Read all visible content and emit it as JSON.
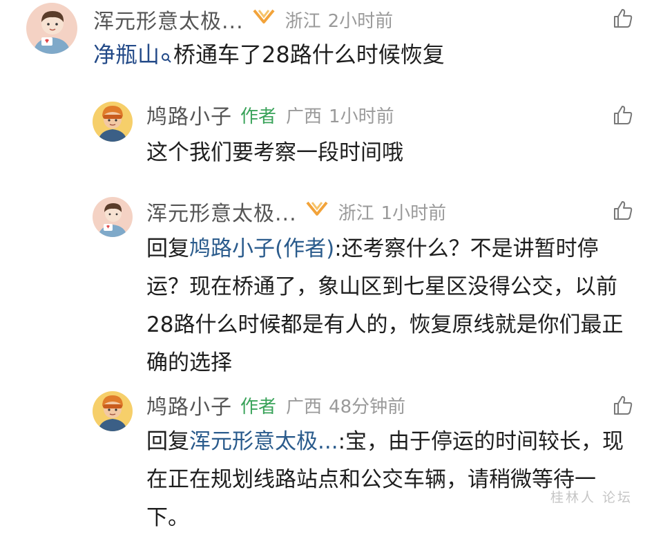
{
  "comments": [
    {
      "user": "浑元形意太极...",
      "location": "浙江",
      "time": "2小时前",
      "topic_link": "净瓶山",
      "text": "桥通车了28路什么时候恢复"
    },
    {
      "user": "鸠路小子",
      "badge": "作者",
      "location": "广西",
      "time": "1小时前",
      "text": "这个我们要考察一段时间哦"
    },
    {
      "user": "浑元形意太极...",
      "location": "浙江",
      "time": "1小时前",
      "reply_prefix": "回复",
      "reply_to": "鸠路小子(作者)",
      "text": ":还考察什么？不是讲暂时停运？现在桥通了，象山区到七星区没得公交，以前28路什么时候都是有人的，恢复原线就是你们最正确的选择"
    },
    {
      "user": "鸠路小子",
      "badge": "作者",
      "location": "广西",
      "time": "48分钟前",
      "reply_prefix": "回复",
      "reply_to": "浑元形意太极...",
      "text": ":宝，由于停运的时间较长，现在正在规划线路站点和公交车辆，请稍微等待一下。"
    }
  ],
  "icons": {
    "vip": "vip-ribbon-icon",
    "like": "thumbs-up-icon",
    "topic_search": "search-icon"
  },
  "colors": {
    "name": "#555555",
    "author_badge": "#3aa35a",
    "mention": "#2a5b8c",
    "meta": "#9a9a9a",
    "vip": "#f2a33a"
  },
  "watermark": "桂林人 论坛"
}
